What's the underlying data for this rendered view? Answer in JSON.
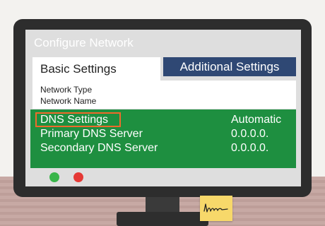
{
  "window": {
    "title": "Configure Network"
  },
  "tabs": [
    {
      "label": "Basic Settings",
      "active": true
    },
    {
      "label": "Additional Settings",
      "active": false
    }
  ],
  "basic_fields": [
    "Network Type",
    "Network Name"
  ],
  "dns_rows": [
    {
      "label": "DNS Settings",
      "value": "Automatic",
      "highlighted": true
    },
    {
      "label": "Primary DNS Server",
      "value": "0.0.0.0."
    },
    {
      "label": "Secondary DNS Server",
      "value": "0.0.0.0."
    }
  ],
  "colors": {
    "tab_additional_bg": "#2f4874",
    "dns_panel_bg": "#1e8f40",
    "highlight_border": "#f06a2b",
    "button_green": "#39b54a",
    "button_red": "#e53935",
    "sticky_note": "#f7d86a"
  }
}
